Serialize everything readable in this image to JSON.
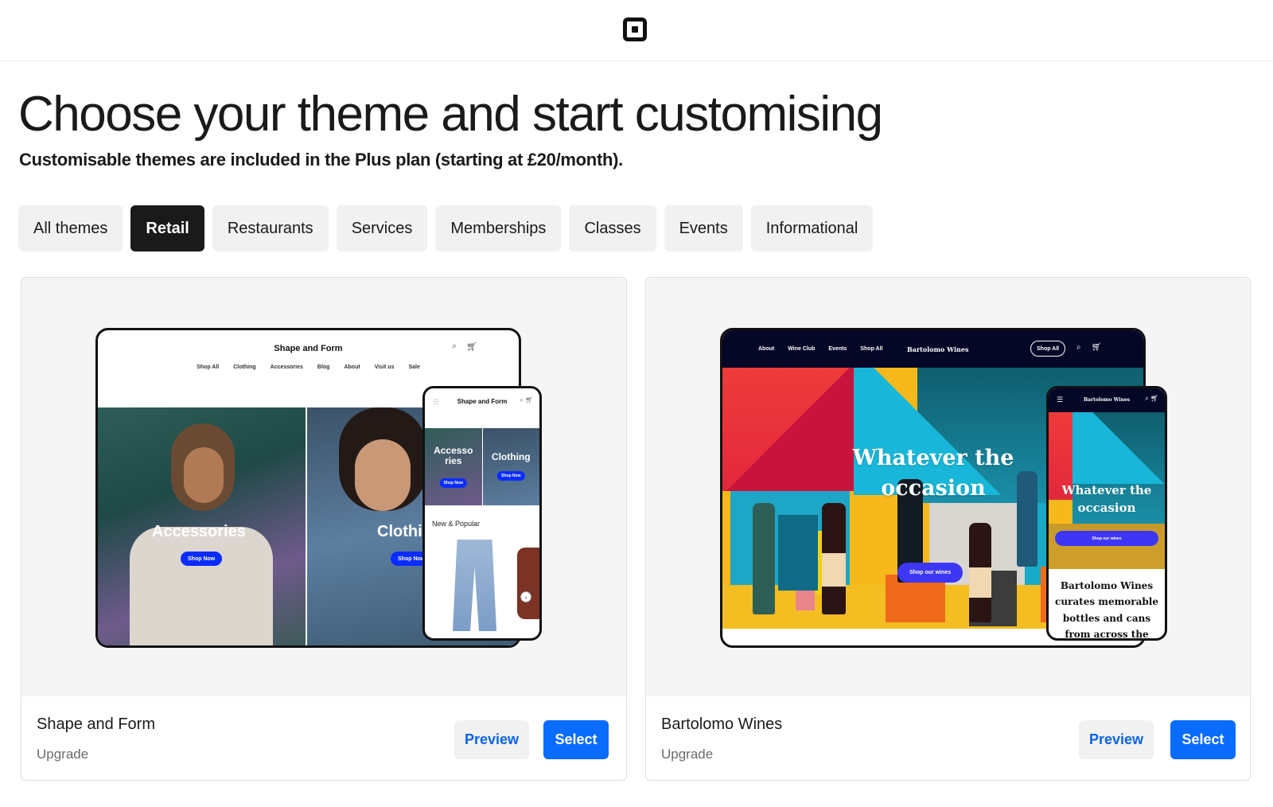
{
  "header": {
    "logo_icon": "square-logo-icon"
  },
  "page": {
    "title": "Choose your theme and start customising",
    "subtitle": "Customisable themes are included in the Plus plan (starting at £20/month)."
  },
  "filters": [
    {
      "label": "All themes",
      "active": false
    },
    {
      "label": "Retail",
      "active": true
    },
    {
      "label": "Restaurants",
      "active": false
    },
    {
      "label": "Services",
      "active": false
    },
    {
      "label": "Memberships",
      "active": false
    },
    {
      "label": "Classes",
      "active": false
    },
    {
      "label": "Events",
      "active": false
    },
    {
      "label": "Informational",
      "active": false
    }
  ],
  "themes": [
    {
      "name": "Shape and Form",
      "tier": "Upgrade",
      "preview_label": "Preview",
      "select_label": "Select",
      "mock": {
        "brand": "Shape and Form",
        "nav": [
          "Shop All",
          "Clothing",
          "Accessories",
          "Blog",
          "About",
          "Visit us",
          "Sale"
        ],
        "hero_left_label": "Accessories",
        "hero_right_label": "Clothing",
        "cta": "Shop Now",
        "phone_tile_1": "Accesso ries",
        "phone_tile_2": "Clothing",
        "phone_section": "New & Popular"
      }
    },
    {
      "name": "Bartolomo Wines",
      "tier": "Upgrade",
      "preview_label": "Preview",
      "select_label": "Select",
      "mock": {
        "brand": "Bartolomo Wines",
        "nav": [
          "About",
          "Wine Club",
          "Events",
          "Shop All"
        ],
        "shop_all_button": "Shop All",
        "headline": "Whatever the occasion",
        "cta": "Shop our wines",
        "phone_text": "Bartolomo Wines curates memorable bottles and cans from across the world."
      }
    }
  ],
  "colors": {
    "primary_blue": "#0a6cff",
    "active_filter": "#1a1a1a",
    "filter_bg": "#f1f1f1"
  }
}
